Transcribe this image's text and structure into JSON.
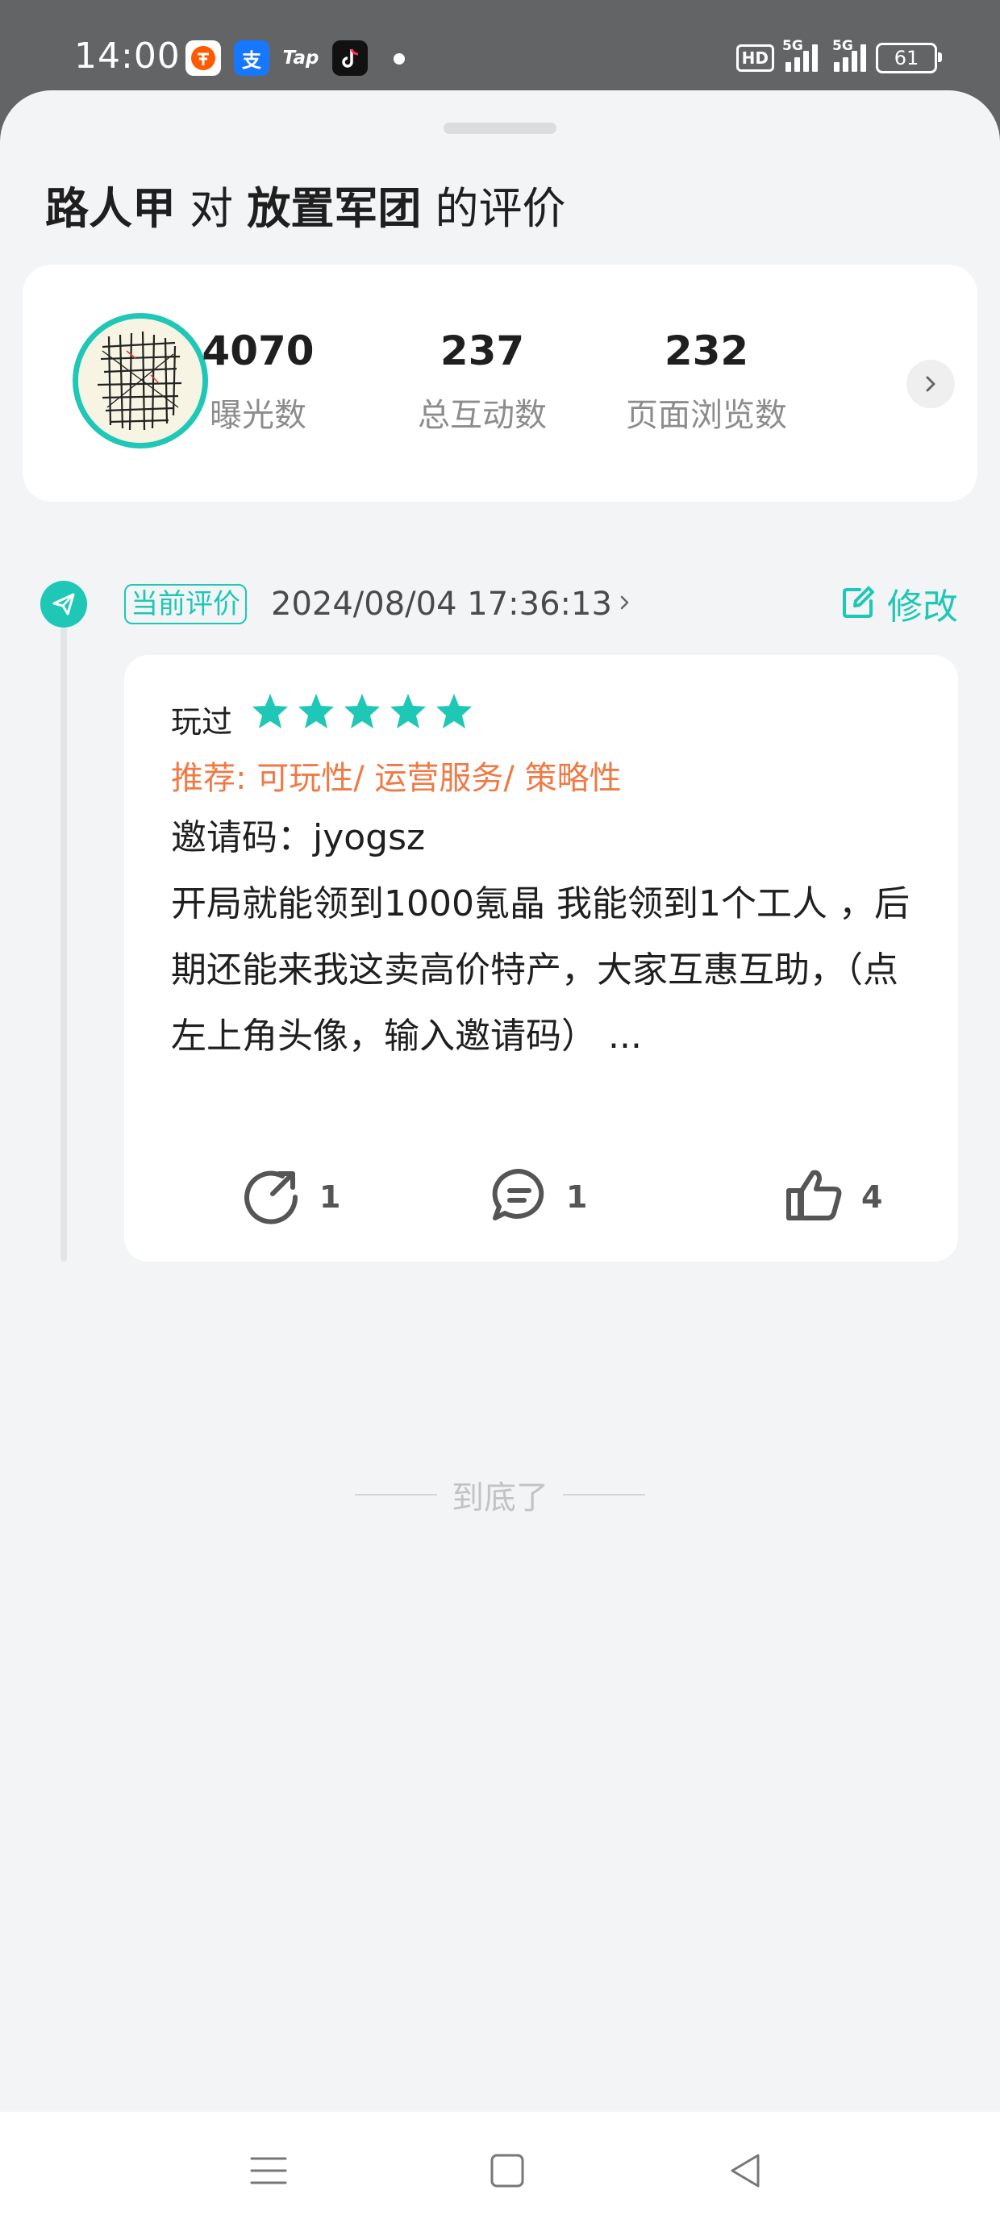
{
  "status_bar": {
    "time": "14:00",
    "app_icons": [
      "taobao-icon",
      "alipay-icon",
      "taptap-icon",
      "tiktok-icon"
    ],
    "taptap_label": "Tap",
    "alipay_label": "支",
    "hd_label": "HD",
    "signal1_label": "5G",
    "signal2_label": "5G",
    "battery": "61"
  },
  "sheet": {
    "title_user": "路人甲",
    "title_mid": " 对 ",
    "title_game": "放置军团",
    "title_suffix": " 的评价"
  },
  "stats": [
    {
      "value": "4070",
      "label": "曝光数"
    },
    {
      "value": "237",
      "label": "总互动数"
    },
    {
      "value": "232",
      "label": "页面浏览数"
    }
  ],
  "review": {
    "badge": "当前评价",
    "timestamp": "2024/08/04 17:36:13",
    "edit_label": "修改",
    "played": "玩过",
    "rating": 5,
    "recommend": "推荐: 可玩性/ 运营服务/ 策略性",
    "content_line1": "邀请码：jyogsz",
    "content_line2": "开局就能领到1000氪晶  我能领到1个工人 ，后期还能来我这卖高价特产，大家互惠互助，（点左上角头像，输入邀请码） ...",
    "share_count": "1",
    "comment_count": "1",
    "like_count": "4"
  },
  "end_text": "到底了",
  "colors": {
    "accent": "#1ec7b6",
    "recommend": "#ef7a45",
    "status_bg": "#636466"
  }
}
